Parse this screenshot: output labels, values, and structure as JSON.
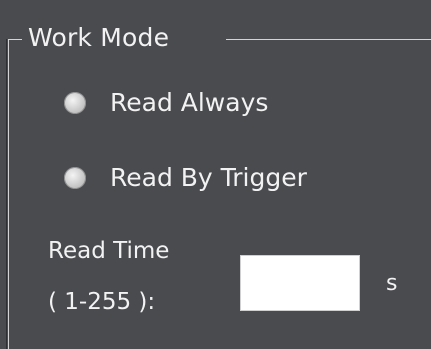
{
  "work_mode": {
    "title": "Work Mode",
    "options": [
      {
        "label": "Read Always",
        "selected": false
      },
      {
        "label": "Read By Trigger",
        "selected": false
      }
    ],
    "read_time": {
      "label_line1": "Read Time",
      "label_line2": "( 1-255 ):",
      "value": "",
      "unit": "s"
    }
  }
}
